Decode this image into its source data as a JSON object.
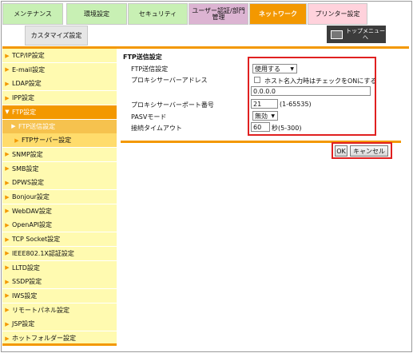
{
  "tabs": [
    {
      "label": "メンテナンス",
      "bg": "#c8f0b4",
      "active": false
    },
    {
      "label": "環境設定",
      "bg": "#c8f0b4",
      "active": false
    },
    {
      "label": "セキュリティ",
      "bg": "#c8f0b4",
      "active": false
    },
    {
      "label": "ユーザー認証/部門管理",
      "bg": "#dcb4d2",
      "active": false
    },
    {
      "label": "ネットワーク",
      "bg": "#f39800",
      "active": true
    },
    {
      "label": "プリンター設定",
      "bg": "#ffd2dc",
      "active": false
    }
  ],
  "subtab": {
    "label": "カスタマイズ設定"
  },
  "top_menu": {
    "label": "トップメニューへ",
    "icon": "top-menu-icon"
  },
  "sidebar": {
    "items": [
      {
        "label": "TCP/IP設定"
      },
      {
        "label": "E-mail設定"
      },
      {
        "label": "LDAP設定"
      },
      {
        "label": "IPP設定"
      },
      {
        "label": "FTP設定"
      },
      {
        "label": "FTP送信設定"
      },
      {
        "label": "FTPサーバー設定"
      },
      {
        "label": "SNMP設定"
      },
      {
        "label": "SMB設定"
      },
      {
        "label": "DPWS設定"
      },
      {
        "label": "Bonjour設定"
      },
      {
        "label": "WebDAV設定"
      },
      {
        "label": "OpenAPI設定"
      },
      {
        "label": "TCP Socket設定"
      },
      {
        "label": "IEEE802.1X認証設定"
      },
      {
        "label": "LLTD設定"
      },
      {
        "label": "SSDP設定"
      },
      {
        "label": "IWS設定"
      },
      {
        "label": "リモートパネル設定"
      },
      {
        "label": "JSP設定"
      },
      {
        "label": "ホットフォルダー設定"
      }
    ]
  },
  "form": {
    "title": "FTP送信設定",
    "ftp_send_label": "FTP送信設定",
    "ftp_send_value": "使用する",
    "proxy_address_label": "プロキシサーバーアドレス",
    "host_name_check_label": "ホスト名入力時はチェックをONにする",
    "proxy_address_value": "0.0.0.0",
    "proxy_port_label": "プロキシサーバーポート番号",
    "proxy_port_value": "21",
    "proxy_port_range": "(1-65535)",
    "pasv_label": "PASVモード",
    "pasv_value": "無効",
    "timeout_label": "接続タイムアウト",
    "timeout_value": "60",
    "timeout_range": "秒(5-300)"
  },
  "buttons": {
    "ok": "OK",
    "cancel": "キャンセル"
  },
  "colors": {
    "accent": "#f39800",
    "highlight": "#e02020",
    "sidebar_bg": "#fffab0"
  }
}
